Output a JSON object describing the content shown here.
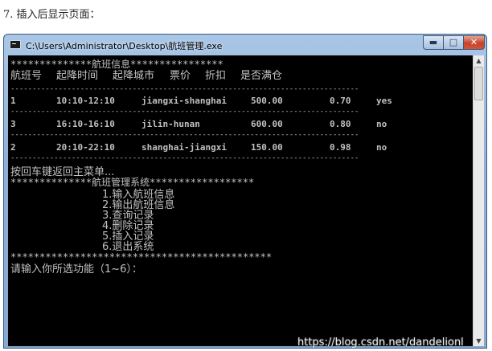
{
  "caption": "7. 插入后显示页面：",
  "window": {
    "title": "C:\\Users\\Administrator\\Desktop\\航班管理.exe",
    "minimize_symbol": "▬",
    "maximize_symbol": "□",
    "close_symbol": "✕"
  },
  "console": {
    "banner": "**************航班信息****************",
    "headers": [
      "航班号",
      "起降时间",
      "起降城市",
      "票价",
      "折扣",
      "是否满仓"
    ],
    "separator": "--------------------------------------------------------------------------------",
    "rows": [
      {
        "no": "1",
        "time": "10:10-12:10",
        "city": "jiangxi-shanghai",
        "price": "500.00",
        "discount": "0.70",
        "full": "yes"
      },
      {
        "no": "3",
        "time": "16:10-16:10",
        "city": "jilin-hunan",
        "price": "600.00",
        "discount": "0.80",
        "full": "no"
      },
      {
        "no": "2",
        "time": "20:10-22:10",
        "city": "shanghai-jiangxi",
        "price": "150.00",
        "discount": "0.98",
        "full": "no"
      }
    ],
    "return_prompt": "按回车键返回主菜单...",
    "menu_banner": "**************航班管理系统******************",
    "menu_items": [
      "1.输入航班信息",
      "2.输出航班信息",
      "3.查询记录",
      "4.删除记录",
      "5.插入记录",
      "6.退出系统"
    ],
    "menu_footer": "*********************************************",
    "input_prompt": "请输入你所选功能（1~6）："
  },
  "watermark": "https://blog.csdn.net/dandelionl"
}
